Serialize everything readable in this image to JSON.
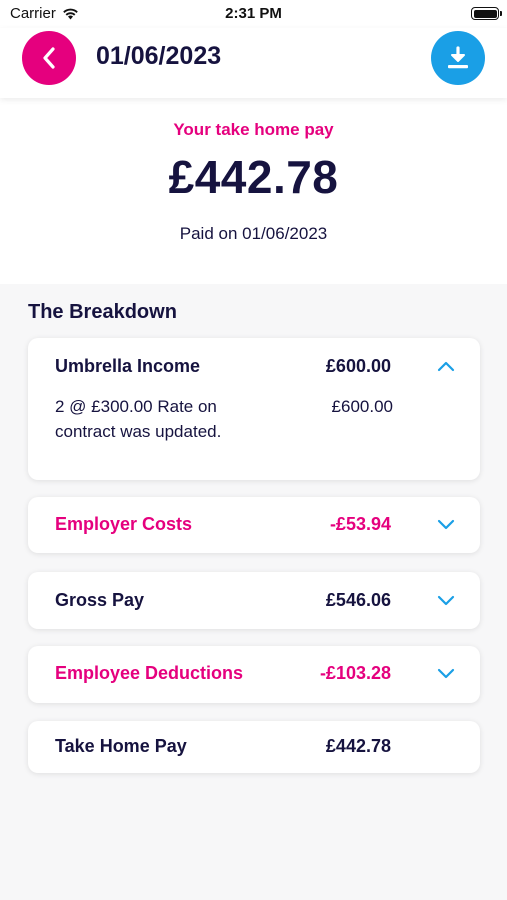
{
  "status_bar": {
    "carrier": "Carrier",
    "time": "2:31 PM"
  },
  "header": {
    "title": "01/06/2023",
    "back_icon": "chevron-left-icon",
    "download_icon": "download-icon",
    "back_color": "#e5007e",
    "download_color": "#1a9fe6"
  },
  "summary": {
    "label": "Your take home pay",
    "amount": "£442.78",
    "paid_on": "Paid on 01/06/2023"
  },
  "breakdown": {
    "title": "The Breakdown",
    "items": [
      {
        "title": "Umbrella Income",
        "amount": "£600.00",
        "expanded": true,
        "detail": {
          "description": "2 @ £300.00 Rate on contract was updated.",
          "amount": "£600.00"
        }
      },
      {
        "title": "Employer Costs",
        "amount": "-£53.94",
        "expanded": false
      },
      {
        "title": "Gross Pay",
        "amount": "£546.06",
        "expanded": false
      },
      {
        "title": "Employee Deductions",
        "amount": "-£103.28",
        "expanded": false
      },
      {
        "title": "Take Home Pay",
        "amount": "£442.78"
      }
    ]
  },
  "colors": {
    "accent_pink": "#e5007e",
    "accent_blue": "#1a9fe6",
    "navy_text": "#16133f"
  }
}
